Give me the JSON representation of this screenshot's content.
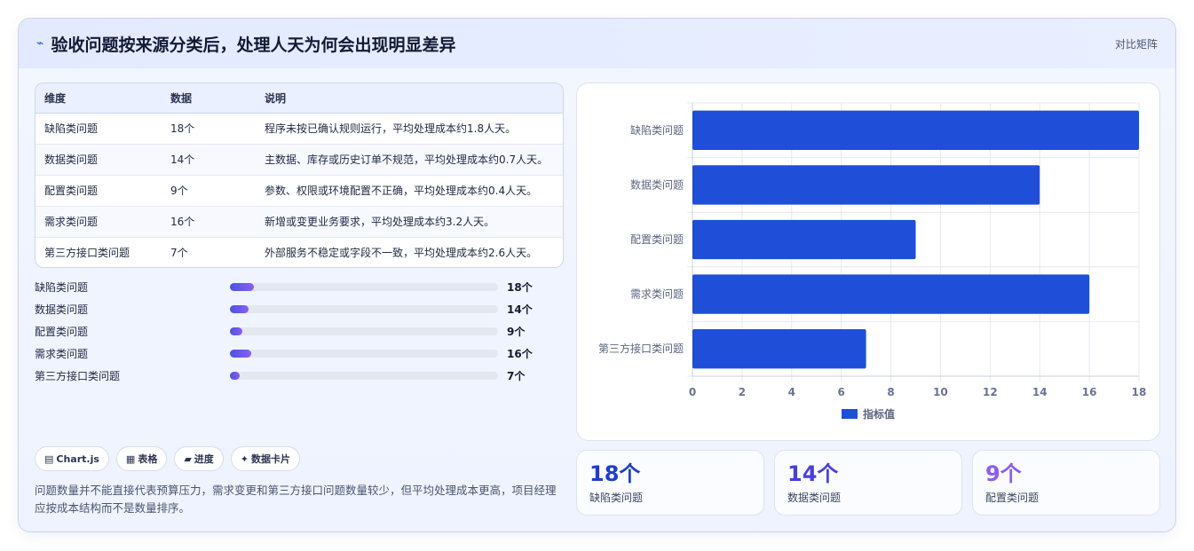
{
  "header": {
    "icon": "trend-icon",
    "title": "验收问题按来源分类后，处理人天为何会出现明显差异",
    "tag": "对比矩阵"
  },
  "table": {
    "headers": [
      "维度",
      "数据",
      "说明"
    ],
    "rows": [
      [
        "缺陷类问题",
        "18个",
        "程序未按已确认规则运行，平均处理成本约1.8人天。"
      ],
      [
        "数据类问题",
        "14个",
        "主数据、库存或历史订单不规范，平均处理成本约0.7人天。"
      ],
      [
        "配置类问题",
        "9个",
        "参数、权限或环境配置不正确，平均处理成本约0.4人天。"
      ],
      [
        "需求类问题",
        "16个",
        "新增或变更业务要求，平均处理成本约3.2人天。"
      ],
      [
        "第三方接口类问题",
        "7个",
        "外部服务不稳定或字段不一致，平均处理成本约2.6人天。"
      ]
    ]
  },
  "progress": {
    "items": [
      {
        "label": "缺陷类问题",
        "value_text": "18个",
        "value": 18
      },
      {
        "label": "数据类问题",
        "value_text": "14个",
        "value": 14
      },
      {
        "label": "配置类问题",
        "value_text": "9个",
        "value": 9
      },
      {
        "label": "需求类问题",
        "value_text": "16个",
        "value": 16
      },
      {
        "label": "第三方接口类问题",
        "value_text": "7个",
        "value": 7
      }
    ],
    "max": 200
  },
  "chips": [
    {
      "icon": "chart-icon",
      "glyph": "▤",
      "label": "Chart.js"
    },
    {
      "icon": "table-icon",
      "glyph": "▦",
      "label": "表格"
    },
    {
      "icon": "progress-icon",
      "glyph": "▰",
      "label": "进度"
    },
    {
      "icon": "sparkle-icon",
      "glyph": "✦",
      "label": "数据卡片"
    }
  ],
  "note": "问题数量并不能直接代表预算压力，需求变更和第三方接口问题数量较少，但平均处理成本更高，项目经理应按成本结构而不是数量排序。",
  "chart_data": {
    "type": "bar",
    "orientation": "horizontal",
    "categories": [
      "缺陷类问题",
      "数据类问题",
      "配置类问题",
      "需求类问题",
      "第三方接口类问题"
    ],
    "series": [
      {
        "name": "指标值",
        "values": [
          18,
          14,
          9,
          16,
          7
        ]
      }
    ],
    "xlim": [
      0,
      18
    ],
    "xticks": [
      0,
      2,
      4,
      6,
      8,
      10,
      12,
      14,
      16,
      18
    ],
    "grid": true,
    "legend": "bottom",
    "color": "#1f4fd8"
  },
  "stats": [
    {
      "value": "18个",
      "label": "缺陷类问题",
      "color": "#1f3fc8"
    },
    {
      "value": "14个",
      "label": "数据类问题",
      "color": "#4b3fd8"
    },
    {
      "value": "9个",
      "label": "配置类问题",
      "color": "#8b5cf0"
    }
  ]
}
